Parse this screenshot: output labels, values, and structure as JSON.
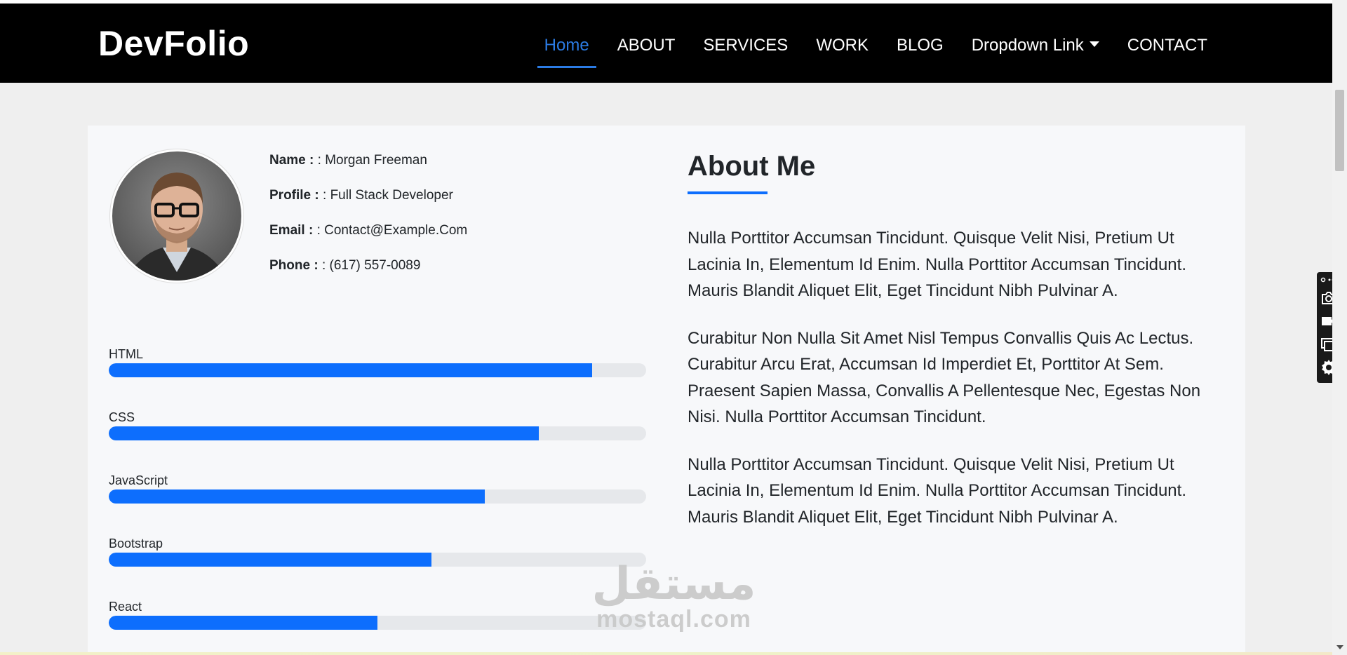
{
  "brand": "DevFolio",
  "nav": {
    "home": "Home",
    "about": "ABOUT",
    "services": "SERVICES",
    "work": "WORK",
    "blog": "BLOG",
    "dropdown": "Dropdown Link",
    "contact": "CONTACT"
  },
  "profile": {
    "name_label": "Name : ",
    "name_value": ": Morgan Freeman",
    "profile_label": "Profile : ",
    "profile_value": ": Full Stack Developer",
    "email_label": "Email : ",
    "email_value": ": Contact@Example.Com",
    "phone_label": "Phone : ",
    "phone_value": ": (617) 557-0089"
  },
  "skills": [
    {
      "label": "HTML",
      "percent": 90
    },
    {
      "label": "CSS",
      "percent": 80
    },
    {
      "label": "JavaScript",
      "percent": 70
    },
    {
      "label": "Bootstrap",
      "percent": 60
    },
    {
      "label": "React",
      "percent": 50
    }
  ],
  "about": {
    "title": "About Me",
    "p1": "Nulla Porttitor Accumsan Tincidunt. Quisque Velit Nisi, Pretium Ut Lacinia In, Elementum Id Enim. Nulla Porttitor Accumsan Tincidunt. Mauris Blandit Aliquet Elit, Eget Tincidunt Nibh Pulvinar A.",
    "p2": "Curabitur Non Nulla Sit Amet Nisl Tempus Convallis Quis Ac Lectus. Curabitur Arcu Erat, Accumsan Id Imperdiet Et, Porttitor At Sem. Praesent Sapien Massa, Convallis A Pellentesque Nec, Egestas Non Nisi. Nulla Porttitor Accumsan Tincidunt.",
    "p3": "Nulla Porttitor Accumsan Tincidunt. Quisque Velit Nisi, Pretium Ut Lacinia In, Elementum Id Enim. Nulla Porttitor Accumsan Tincidunt. Mauris Blandit Aliquet Elit, Eget Tincidunt Nibh Pulvinar A."
  },
  "watermark": {
    "arabic": "مستقل",
    "latin": "mostaql.com"
  },
  "colors": {
    "accent": "#0d6efd",
    "nav_active": "#2b7be4",
    "navbar_bg": "#000000"
  },
  "icons": {
    "toolbar": [
      "settings-dots-icon",
      "camera-icon",
      "video-icon",
      "window-icon",
      "gear-icon"
    ],
    "dropdown": "caret-down-icon"
  }
}
